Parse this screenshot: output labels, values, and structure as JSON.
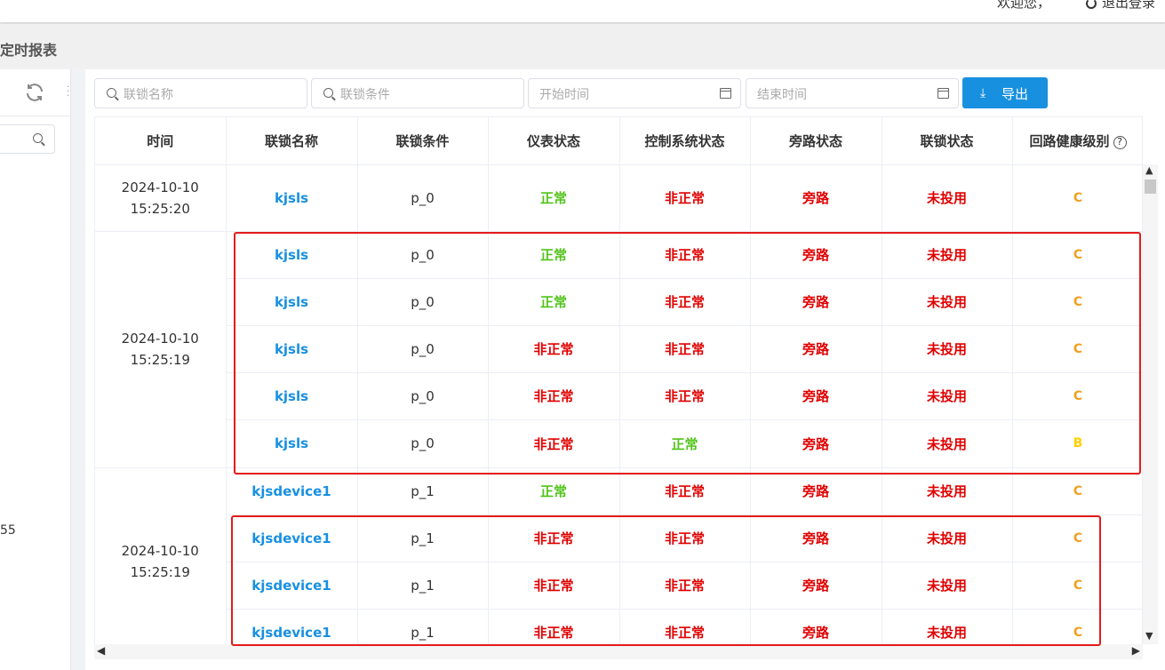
{
  "header": {
    "welcome": "欢迎您，",
    "logout": "退出登录"
  },
  "page": {
    "title": "定时报表"
  },
  "left": {
    "number": "55"
  },
  "filters": {
    "interlock_name_placeholder": "联锁名称",
    "condition_placeholder": "联锁条件",
    "start_placeholder": "开始时间",
    "end_placeholder": "结束时间",
    "export_label": "导出"
  },
  "table": {
    "columns": [
      "时间",
      "联锁名称",
      "联锁条件",
      "仪表状态",
      "控制系统状态",
      "旁路状态",
      "联锁状态",
      "回路健康级别"
    ],
    "groups": [
      {
        "time_date": "2024-10-10",
        "time_clock": "15:25:20",
        "rows": [
          {
            "name": "kjsls",
            "cond": "p_0",
            "instrument": "正常",
            "control": "非正常",
            "bypass": "旁路",
            "interlock": "未投用",
            "level": "C"
          }
        ]
      },
      {
        "time_date": "2024-10-10",
        "time_clock": "15:25:19",
        "rows": [
          {
            "name": "kjsls",
            "cond": "p_0",
            "instrument": "正常",
            "control": "非正常",
            "bypass": "旁路",
            "interlock": "未投用",
            "level": "C"
          },
          {
            "name": "kjsls",
            "cond": "p_0",
            "instrument": "正常",
            "control": "非正常",
            "bypass": "旁路",
            "interlock": "未投用",
            "level": "C"
          },
          {
            "name": "kjsls",
            "cond": "p_0",
            "instrument": "非正常",
            "control": "非正常",
            "bypass": "旁路",
            "interlock": "未投用",
            "level": "C"
          },
          {
            "name": "kjsls",
            "cond": "p_0",
            "instrument": "非正常",
            "control": "非正常",
            "bypass": "旁路",
            "interlock": "未投用",
            "level": "C"
          },
          {
            "name": "kjsls",
            "cond": "p_0",
            "instrument": "非正常",
            "control": "正常",
            "bypass": "旁路",
            "interlock": "未投用",
            "level": "B"
          }
        ]
      },
      {
        "time_date": "2024-10-10",
        "time_clock": "15:25:19",
        "rows": [
          {
            "name": "kjsdevice1",
            "cond": "p_1",
            "instrument": "正常",
            "control": "非正常",
            "bypass": "旁路",
            "interlock": "未投用",
            "level": "C"
          },
          {
            "name": "kjsdevice1",
            "cond": "p_1",
            "instrument": "非正常",
            "control": "非正常",
            "bypass": "旁路",
            "interlock": "未投用",
            "level": "C"
          },
          {
            "name": "kjsdevice1",
            "cond": "p_1",
            "instrument": "非正常",
            "control": "非正常",
            "bypass": "旁路",
            "interlock": "未投用",
            "level": "C"
          },
          {
            "name": "kjsdevice1",
            "cond": "p_1",
            "instrument": "非正常",
            "control": "非正常",
            "bypass": "旁路",
            "interlock": "未投用",
            "level": "C"
          }
        ]
      }
    ]
  },
  "colors": {
    "ok": "#52c41a",
    "bad": "#e00000",
    "link": "#1890e0",
    "level_c": "#f0a020",
    "level_b": "#ffd000",
    "highlight": "#e31b1b"
  }
}
